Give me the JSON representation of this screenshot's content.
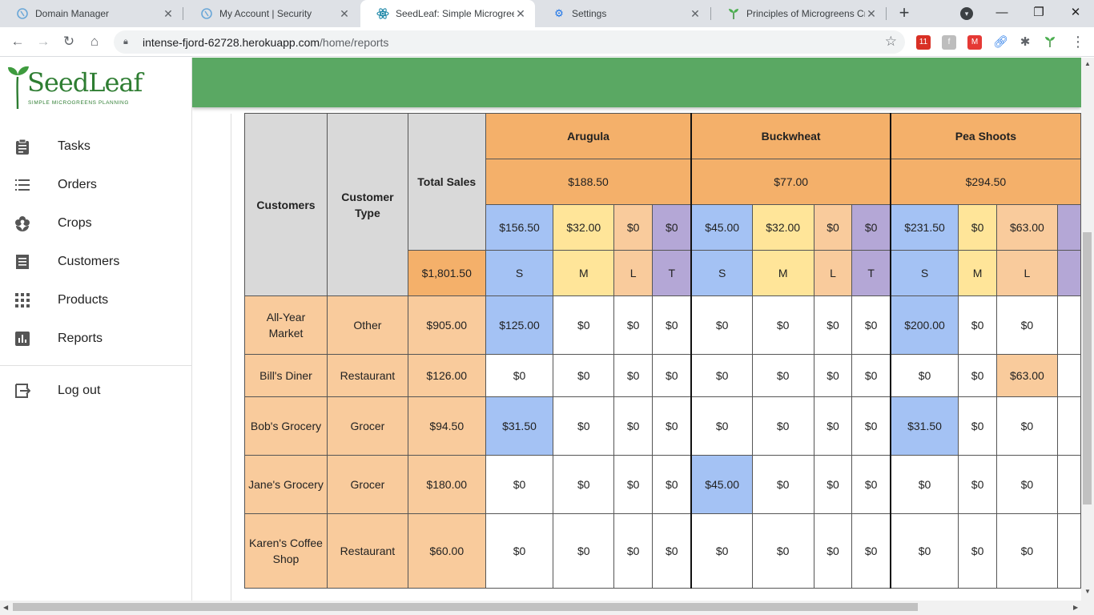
{
  "browser": {
    "tabs": [
      {
        "title": "Domain Manager",
        "icon": "hash-icon"
      },
      {
        "title": "My Account | Security",
        "icon": "hash-icon"
      },
      {
        "title": "SeedLeaf: Simple Microgreen",
        "icon": "react-icon",
        "active": true
      },
      {
        "title": "Settings",
        "icon": "gear-icon"
      },
      {
        "title": "Principles of Microgreens Cro",
        "icon": "sprout-icon"
      }
    ],
    "url_host": "intense-fjord-62728.herokuapp.com",
    "url_path": "/home/reports",
    "calendar_badge": "11"
  },
  "sidebar": {
    "logo_text": "SeedLeaf",
    "logo_tagline": "SIMPLE MICROGREENS PLANNING",
    "items": [
      {
        "label": "Tasks",
        "icon": "clipboard-icon"
      },
      {
        "label": "Orders",
        "icon": "list-icon"
      },
      {
        "label": "Crops",
        "icon": "flower-icon"
      },
      {
        "label": "Customers",
        "icon": "contacts-icon"
      },
      {
        "label": "Products",
        "icon": "grid-icon"
      },
      {
        "label": "Reports",
        "icon": "bar-chart-icon"
      }
    ],
    "logout_label": "Log out"
  },
  "report": {
    "headers": {
      "customers": "Customers",
      "customer_type": "Customer Type",
      "total_sales": "Total Sales",
      "grand_total": "$1,801.50"
    },
    "crops": [
      {
        "name": "Arugula",
        "total": "$188.50",
        "size_totals": [
          "$156.50",
          "$32.00",
          "$0",
          "$0"
        ],
        "sizes": [
          "S",
          "M",
          "L",
          "T"
        ]
      },
      {
        "name": "Buckwheat",
        "total": "$77.00",
        "size_totals": [
          "$45.00",
          "$32.00",
          "$0",
          "$0"
        ],
        "sizes": [
          "S",
          "M",
          "L",
          "T"
        ]
      },
      {
        "name": "Pea Shoots",
        "total": "$294.50",
        "size_totals": [
          "$231.50",
          "$0",
          "$63.00"
        ],
        "sizes": [
          "S",
          "M",
          "L"
        ]
      }
    ],
    "rows": [
      {
        "customer": "All-Year Market",
        "type": "Other",
        "total": "$905.00",
        "values": [
          "$125.00",
          "$0",
          "$0",
          "$0",
          "$0",
          "$0",
          "$0",
          "$0",
          "$200.00",
          "$0",
          "$0"
        ]
      },
      {
        "customer": "Bill's Diner",
        "type": "Restaurant",
        "total": "$126.00",
        "values": [
          "$0",
          "$0",
          "$0",
          "$0",
          "$0",
          "$0",
          "$0",
          "$0",
          "$0",
          "$0",
          "$63.00"
        ]
      },
      {
        "customer": "Bob's Grocery",
        "type": "Grocer",
        "total": "$94.50",
        "values": [
          "$31.50",
          "$0",
          "$0",
          "$0",
          "$0",
          "$0",
          "$0",
          "$0",
          "$31.50",
          "$0",
          "$0"
        ]
      },
      {
        "customer": "Jane's Grocery",
        "type": "Grocer",
        "total": "$180.00",
        "values": [
          "$0",
          "$0",
          "$0",
          "$0",
          "$45.00",
          "$0",
          "$0",
          "$0",
          "$0",
          "$0",
          "$0"
        ]
      },
      {
        "customer": "Karen's Coffee Shop",
        "type": "Restaurant",
        "total": "$60.00",
        "values": [
          "$0",
          "$0",
          "$0",
          "$0",
          "$0",
          "$0",
          "$0",
          "$0",
          "$0",
          "$0",
          "$0"
        ]
      }
    ]
  },
  "colors": {
    "header_bar": "#5aa863",
    "small": "#a4c2f4",
    "medium": "#ffe599",
    "large": "#f9cb9c",
    "tray": "#b4a7d6",
    "crop_header": "#f4b06a"
  }
}
